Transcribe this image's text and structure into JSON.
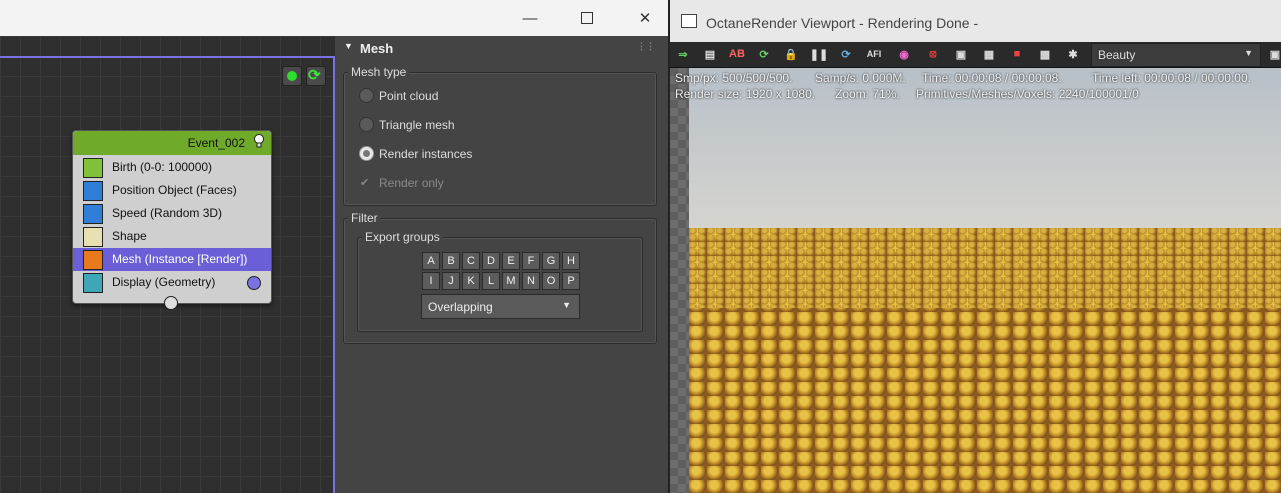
{
  "colors": {
    "accent_selection": "#6a5fd6",
    "event_header": "#6faa2a",
    "canvas_border": "#7b70e6"
  },
  "window": {
    "minimize_icon": "minimize-icon",
    "maximize_icon": "maximize-icon",
    "close_icon": "close-icon"
  },
  "event": {
    "title": "Event_002",
    "operators": [
      {
        "label": "Birth (0-0: 100000)",
        "icon": "birth-icon"
      },
      {
        "label": "Position Object (Faces)",
        "icon": "position-object-icon"
      },
      {
        "label": "Speed (Random 3D)",
        "icon": "speed-icon"
      },
      {
        "label": "Shape",
        "icon": "shape-icon"
      },
      {
        "label": "Mesh (Instance [Render])",
        "icon": "mesh-icon",
        "selected": true
      },
      {
        "label": "Display (Geometry)",
        "icon": "display-icon"
      }
    ]
  },
  "panel": {
    "header": "Mesh",
    "mesh_type": {
      "title": "Mesh type",
      "options": [
        "Point cloud",
        "Triangle mesh",
        "Render instances"
      ],
      "selected": "Render instances",
      "render_only": "Render only",
      "render_only_checked": true
    },
    "filter": {
      "title": "Filter",
      "export_groups": "Export groups",
      "letters_row1": [
        "A",
        "B",
        "C",
        "D",
        "E",
        "F",
        "G",
        "H"
      ],
      "letters_row2": [
        "I",
        "J",
        "K",
        "L",
        "M",
        "N",
        "O",
        "P"
      ],
      "dropdown_value": "Overlapping"
    }
  },
  "viewport": {
    "title": "OctaneRender Viewport - Rendering Done -",
    "toolbar_ab": "AB",
    "toolbar_afi": "AFI",
    "pass_select": "Beauty",
    "stats": {
      "smp": "Smp/px: 500/500/500.",
      "samps": "Samp/s: 0.000M.",
      "time": "Time: 00:00:08 / 00:00:08.",
      "time_left": "Time left: 00:00:08 / 00:00:00.",
      "render_size": "Render size: 1920 x 1080.",
      "zoom": "Zoom: 71%.",
      "primitives": "Primitives/Meshes/Voxels: 2240/100001/0"
    }
  }
}
